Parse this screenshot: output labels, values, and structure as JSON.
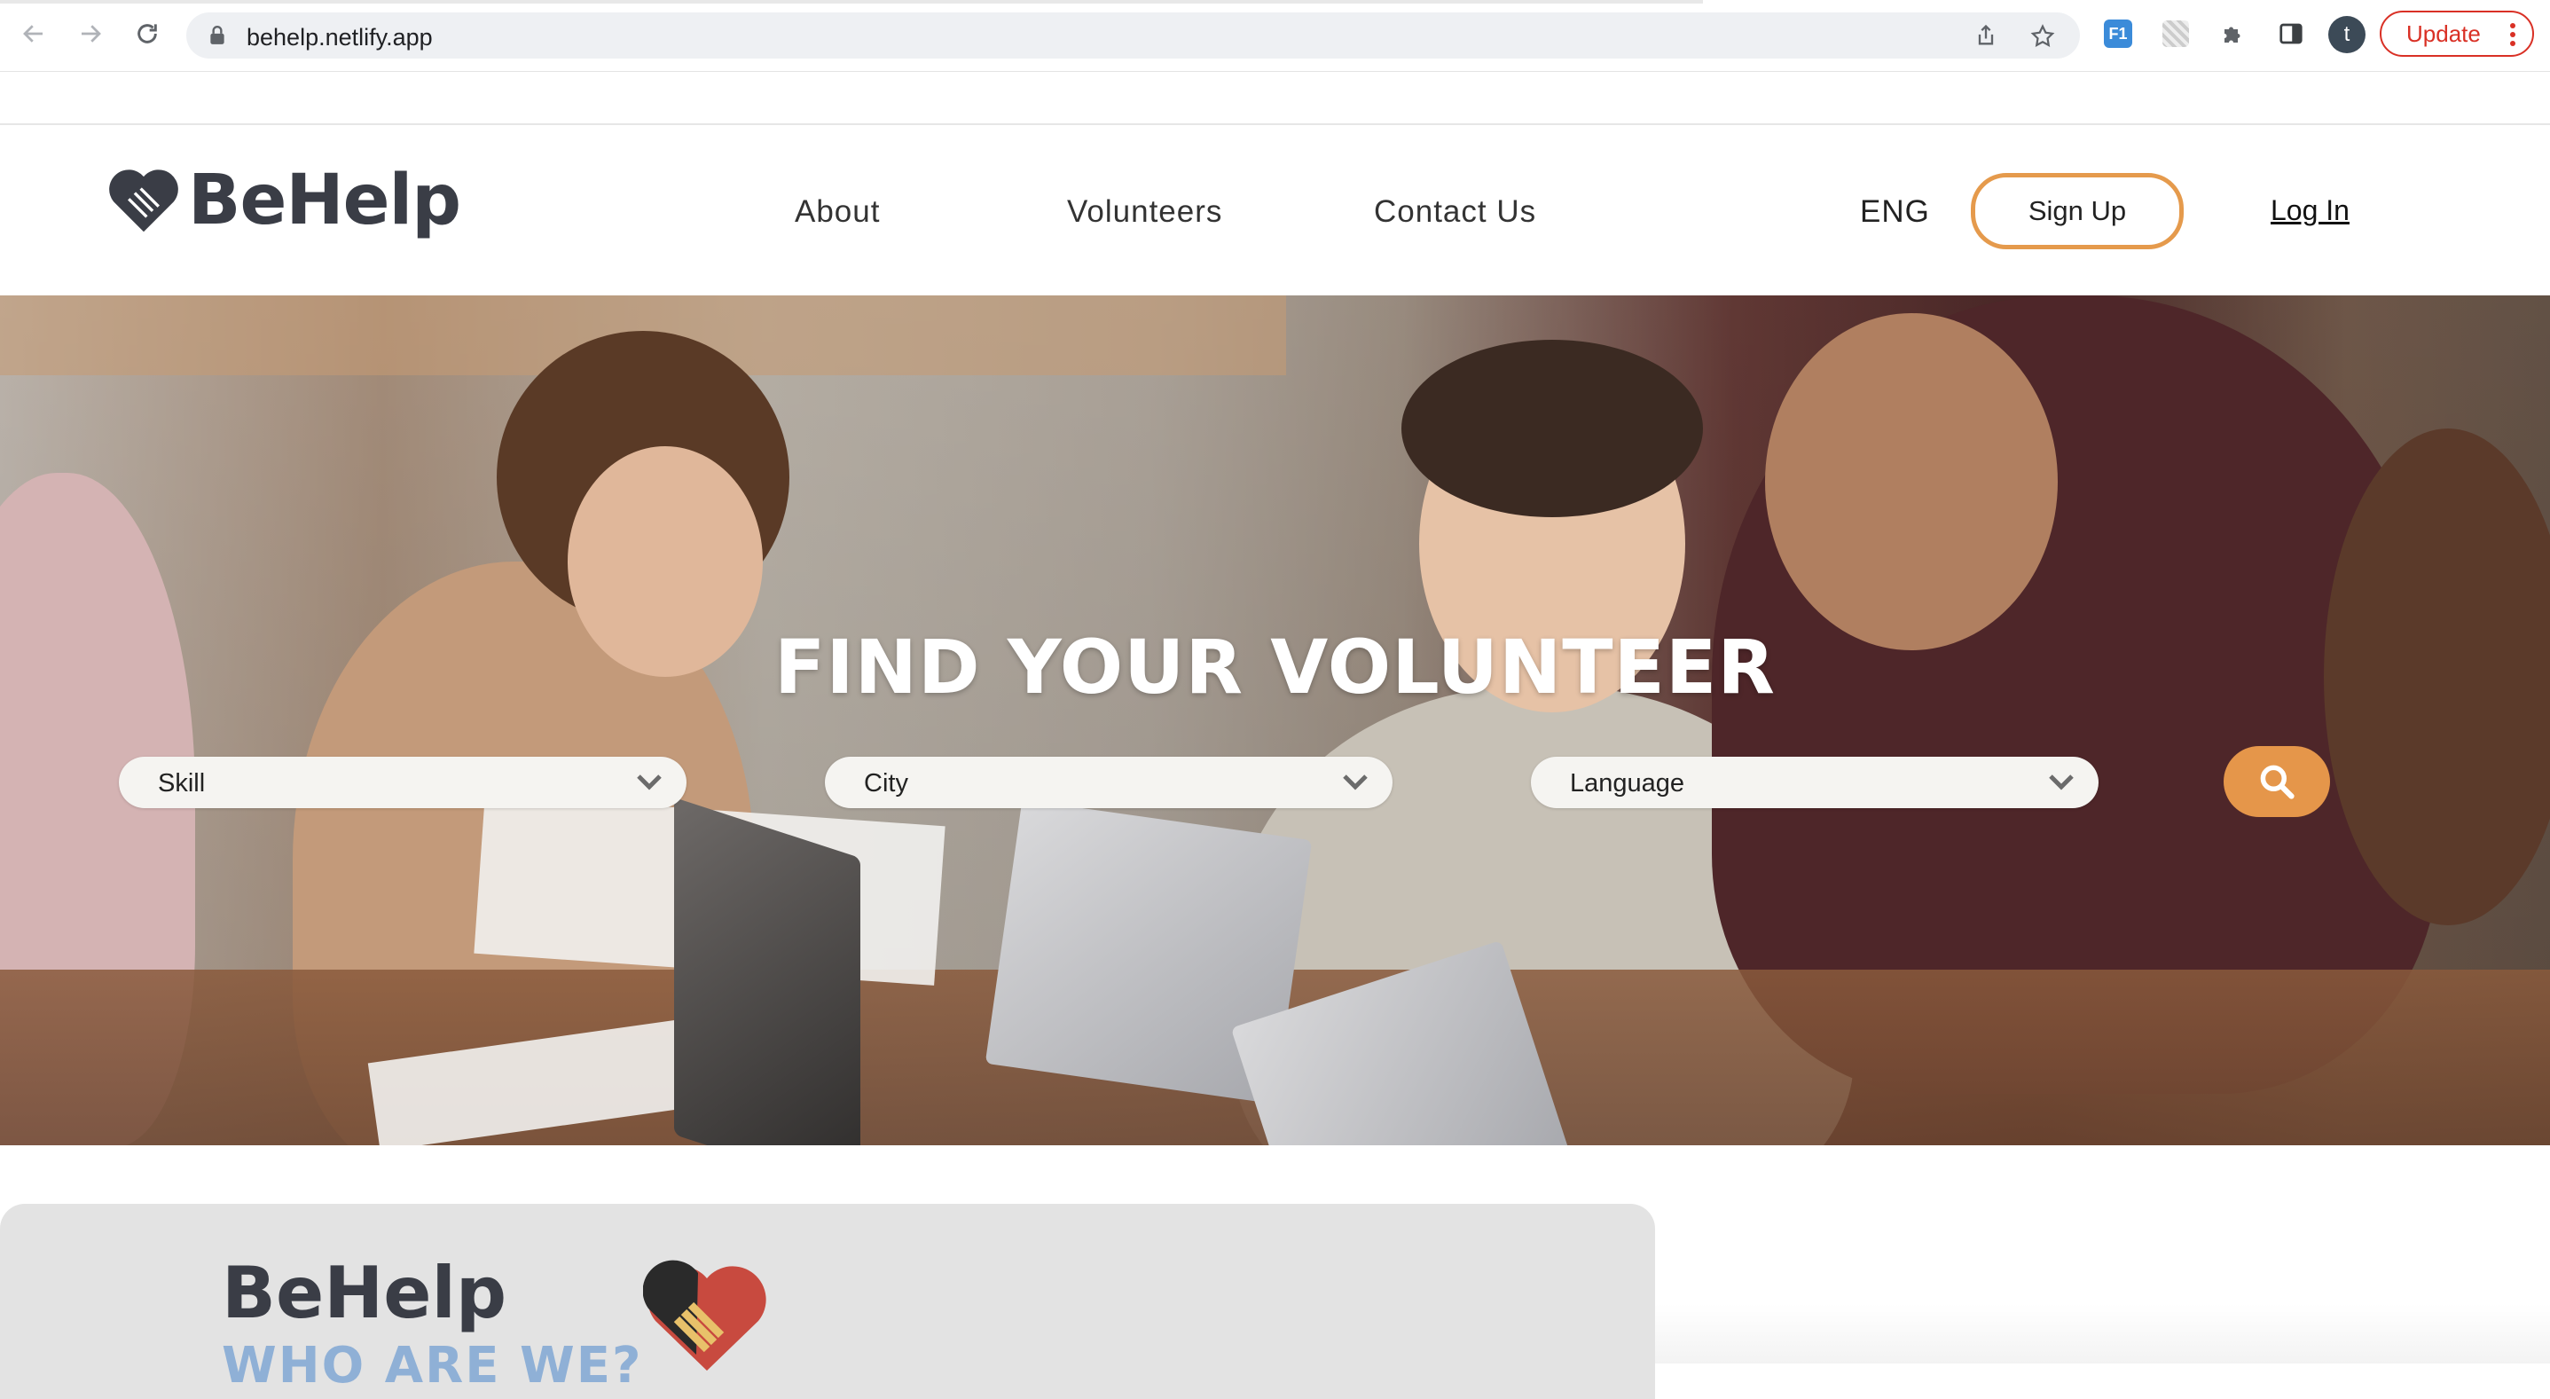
{
  "browser": {
    "url": "behelp.netlify.app",
    "profile_initial": "t",
    "update_label": "Update",
    "ext_badge": "F1"
  },
  "header": {
    "brand": "BeHelp",
    "nav": {
      "about": "About",
      "volunteers": "Volunteers",
      "contact": "Contact Us"
    },
    "language": "ENG",
    "signup": "Sign Up",
    "login": "Log In"
  },
  "hero": {
    "title": "FIND YOUR VOLUNTEER",
    "filters": {
      "skill": "Skill",
      "city": "City",
      "language": "Language"
    }
  },
  "about": {
    "title": "BeHelp",
    "subtitle": "WHO ARE WE?"
  },
  "colors": {
    "accent_orange": "#e5964a",
    "brand_dark": "#3a3d46",
    "subtitle_blue": "#8fb0d6",
    "update_red": "#d93025"
  }
}
